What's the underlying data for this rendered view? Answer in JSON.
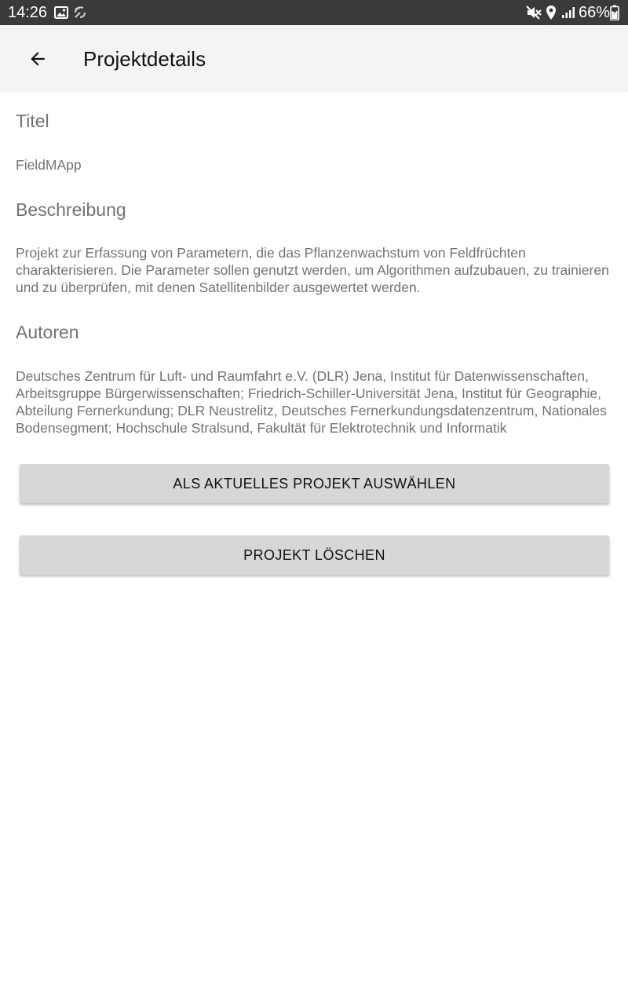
{
  "status_bar": {
    "time": "14:26",
    "battery": "66%",
    "icons": [
      "image-icon",
      "nfc-icon",
      "mute-icon",
      "location-icon",
      "signal-icon",
      "battery-icon"
    ]
  },
  "app_bar": {
    "back_icon": "arrow-back-icon",
    "title": "Projektdetails"
  },
  "sections": {
    "title_label": "Titel",
    "title_value": "FieldMApp",
    "description_label": "Beschreibung",
    "description_value": "Projekt zur Erfassung von Parametern, die das Pflanzenwachstum von Feldfrüchten charakterisieren. Die Parameter sollen genutzt werden, um Algorithmen aufzubauen, zu trainieren und zu überprüfen, mit denen Satellitenbilder ausgewertet werden.",
    "authors_label": "Autoren",
    "authors_value": "Deutsches Zentrum für Luft- und Raumfahrt e.V. (DLR) Jena, Institut für Datenwissenschaften, Arbeitsgruppe Bürgerwissenschaften; Friedrich-Schiller-Universität Jena, Institut für Geographie, Abteilung Fernerkundung; DLR Neustrelitz, Deutsches Fernerkundungsdatenzentrum, Nationales Bodensegment; Hochschule Stralsund, Fakultät für Elektrotechnik und Informatik"
  },
  "buttons": {
    "select": "ALS AKTUELLES PROJEKT AUSWÄHLEN",
    "delete": "PROJEKT LÖSCHEN"
  }
}
